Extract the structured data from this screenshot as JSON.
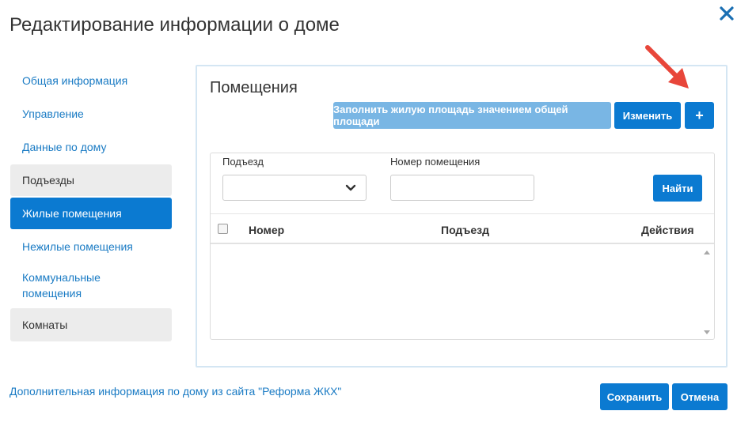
{
  "modal": {
    "title": "Редактирование информации о доме",
    "close_icon": "close-icon"
  },
  "nav": {
    "general": "Общая информация",
    "management": "Управление",
    "house_data": "Данные по дому",
    "entrances": "Подъезды",
    "residential": "Жилые помещения",
    "nonresidential": "Нежилые помещения",
    "communal": "Коммунальные помещения",
    "rooms": "Комнаты"
  },
  "panel": {
    "title": "Помещения",
    "fill_button": "Заполнить жилую площадь значением общей площади",
    "edit_button": "Изменить",
    "add_button": "+"
  },
  "filter": {
    "entrance_label": "Подъезд",
    "entrance_value": "",
    "number_label": "Номер помещения",
    "number_value": "",
    "find_button": "Найти"
  },
  "table": {
    "col_number": "Номер",
    "col_entrance": "Подъезд",
    "col_actions": "Действия"
  },
  "footer": {
    "link": "Дополнительная информация по дому из сайта \"Реформа ЖКХ\"",
    "save_button": "Сохранить",
    "cancel_button": "Отмена"
  },
  "colors": {
    "primary": "#0b7ad1",
    "primary_disabled": "#79b6e4",
    "link": "#1a7bc4",
    "annotation_arrow": "#e8463a"
  }
}
